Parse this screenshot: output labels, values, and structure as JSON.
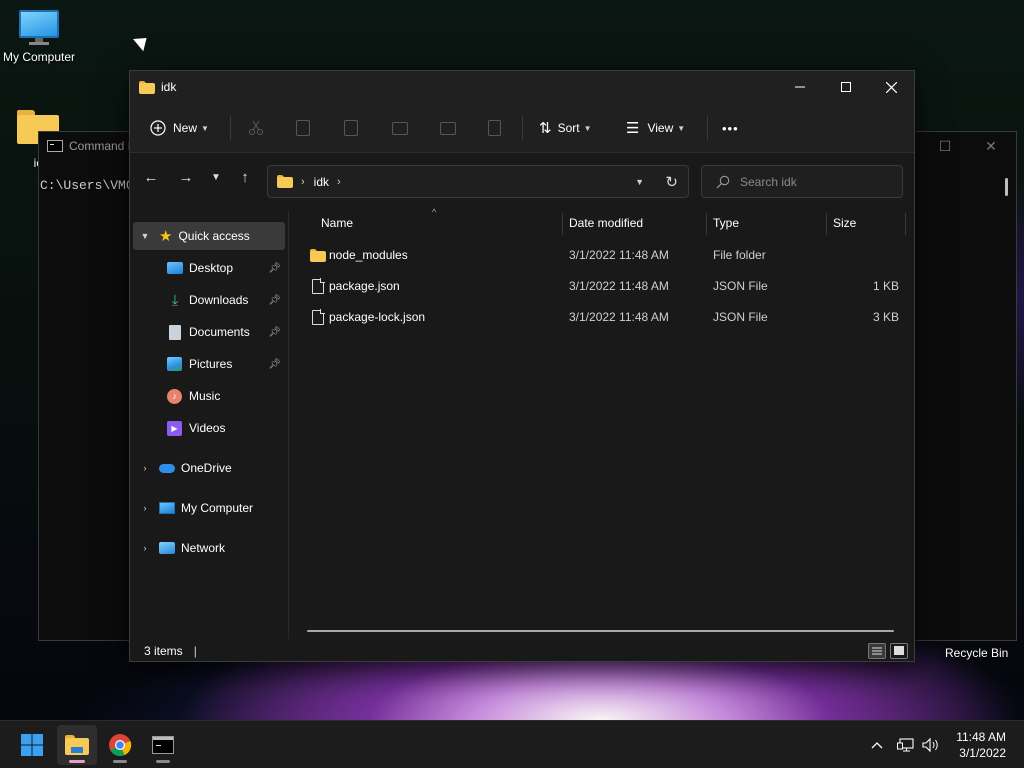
{
  "desktop": {
    "icons": [
      {
        "label": "My Computer",
        "icon": "computer-icon"
      },
      {
        "label": "ic",
        "icon": "folder-icon"
      }
    ],
    "recycle_bin_label": "Recycle Bin"
  },
  "cmd_window": {
    "title": "Command F",
    "prompt": "C:\\Users\\VMC"
  },
  "explorer": {
    "title": "idk",
    "toolbar": {
      "new_label": "New",
      "sort_label": "Sort",
      "view_label": "View",
      "more_label": "•••",
      "disabled_actions": [
        "cut-icon",
        "copy-icon",
        "paste-icon",
        "rename-icon",
        "share-icon",
        "delete-icon"
      ]
    },
    "address": {
      "crumbs": [
        "idk"
      ]
    },
    "search": {
      "placeholder": "Search idk"
    },
    "nav": {
      "quick_access": "Quick access",
      "pinned": [
        {
          "label": "Desktop",
          "icon": "desktop-icon",
          "pinned": true
        },
        {
          "label": "Downloads",
          "icon": "downloads-icon",
          "pinned": true
        },
        {
          "label": "Documents",
          "icon": "documents-icon",
          "pinned": true
        },
        {
          "label": "Pictures",
          "icon": "pictures-icon",
          "pinned": true
        },
        {
          "label": "Music",
          "icon": "music-icon",
          "pinned": false
        },
        {
          "label": "Videos",
          "icon": "videos-icon",
          "pinned": false
        }
      ],
      "roots": [
        {
          "label": "OneDrive",
          "icon": "onedrive-icon"
        },
        {
          "label": "My Computer",
          "icon": "computer-icon"
        },
        {
          "label": "Network",
          "icon": "network-icon"
        }
      ]
    },
    "columns": {
      "name": "Name",
      "date": "Date modified",
      "type": "Type",
      "size": "Size"
    },
    "files": [
      {
        "name": "node_modules",
        "date": "3/1/2022 11:48 AM",
        "type": "File folder",
        "size": "",
        "icon": "folder-icon"
      },
      {
        "name": "package.json",
        "date": "3/1/2022 11:48 AM",
        "type": "JSON File",
        "size": "1 KB",
        "icon": "file-icon"
      },
      {
        "name": "package-lock.json",
        "date": "3/1/2022 11:48 AM",
        "type": "JSON File",
        "size": "3 KB",
        "icon": "file-icon"
      }
    ],
    "status": {
      "item_count": "3 items"
    }
  },
  "taskbar": {
    "apps": [
      {
        "name": "start",
        "icon": "windows-start-icon"
      },
      {
        "name": "file-explorer",
        "icon": "file-explorer-icon",
        "active": true
      },
      {
        "name": "chrome",
        "icon": "chrome-icon"
      },
      {
        "name": "terminal",
        "icon": "command-prompt-icon"
      }
    ],
    "time": "11:48 AM",
    "date": "3/1/2022"
  },
  "colors": {
    "folder": "#f7ca55",
    "accent_star": "#f5c518",
    "window_bg": "#191919",
    "taskbar_bg": "#1c1c1c"
  }
}
